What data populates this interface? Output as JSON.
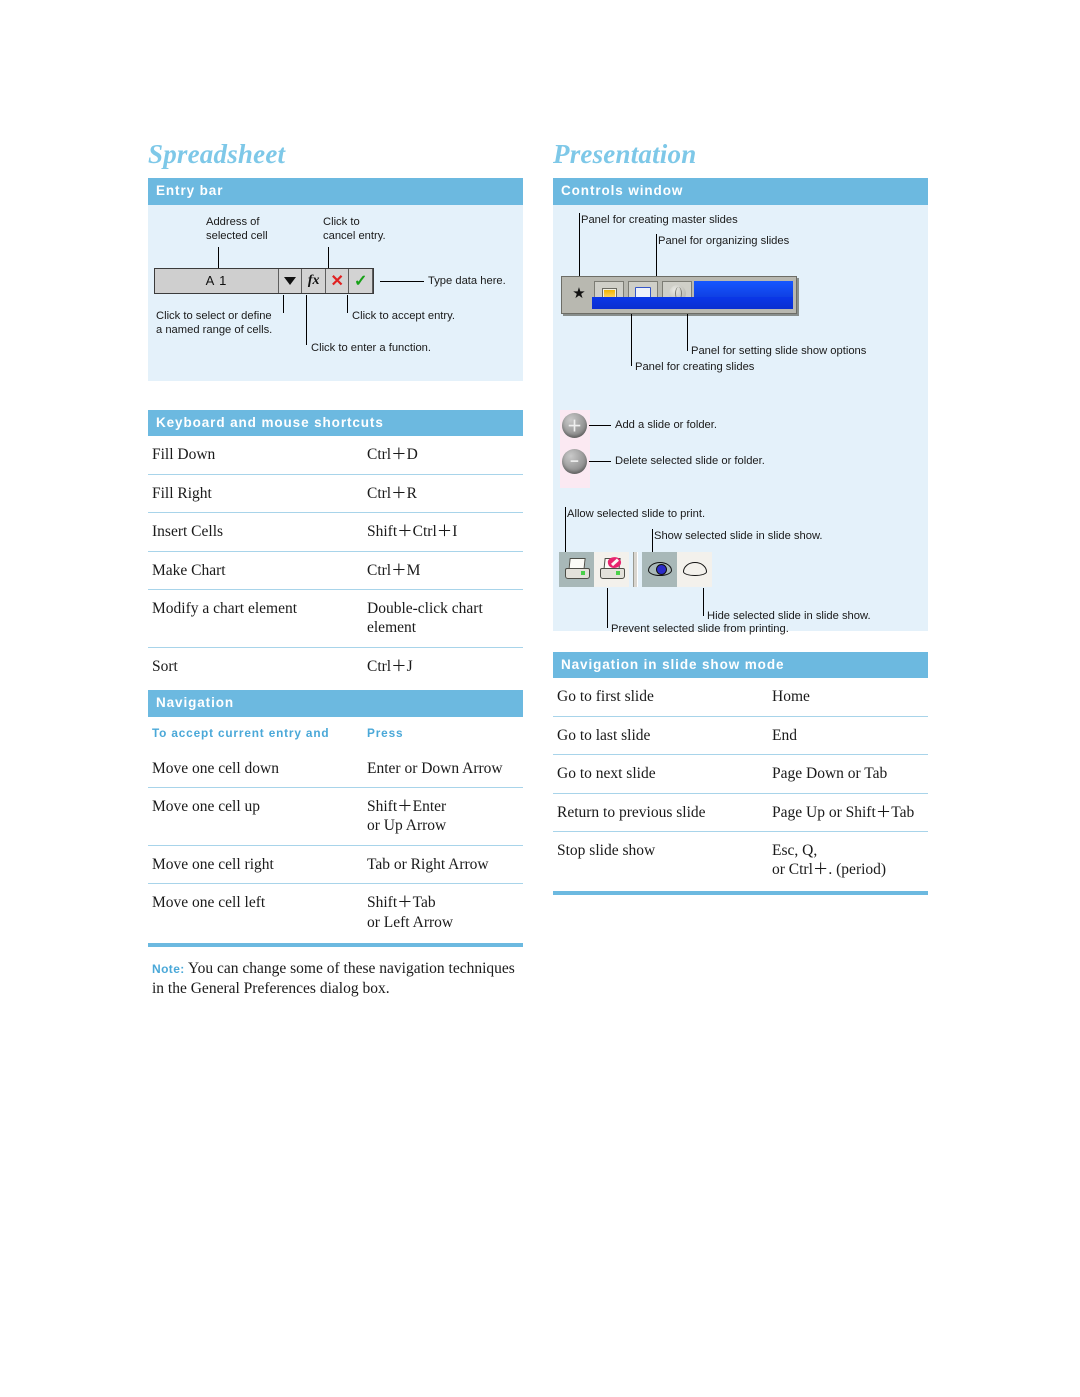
{
  "colors": {
    "accent_bar": "#6cb9e0",
    "title_blue": "#7ec8e8",
    "panel_bg": "#e4f1fa",
    "rule_blue": "#a8d4ea",
    "label_blue": "#4aa8d8"
  },
  "left": {
    "title": "Spreadsheet",
    "entry_bar": {
      "bar_label": "Entry bar",
      "callouts": {
        "address": "Address of\nselected cell",
        "cancel": "Click to\ncancel entry.",
        "type_here": "Type data here.",
        "named_range": "Click to select or define\na named range of cells.",
        "accept": "Click to accept entry.",
        "function": "Click to enter a function."
      },
      "widget": {
        "cell_address": "A 1",
        "dropdown_icon": "caret-down-icon",
        "function_label": "fx",
        "cancel_label": "✕",
        "accept_label": "✓"
      }
    },
    "shortcuts": {
      "bar_label": "Keyboard and mouse shortcuts",
      "rows": [
        {
          "action": "Fill Down",
          "keys": "Ctrl＋D"
        },
        {
          "action": "Fill Right",
          "keys": "Ctrl＋R"
        },
        {
          "action": "Insert Cells",
          "keys": "Shift＋Ctrl＋I"
        },
        {
          "action": "Make Chart",
          "keys": "Ctrl＋M"
        },
        {
          "action": "Modify a chart element",
          "keys": "Double-click chart element"
        },
        {
          "action": "Sort",
          "keys": "Ctrl＋J"
        }
      ]
    },
    "navigation": {
      "bar_label": "Navigation",
      "col1_header": "To accept current entry and",
      "col2_header": "Press",
      "rows": [
        {
          "action": "Move one cell down",
          "keys": "Enter or Down Arrow"
        },
        {
          "action": "Move one cell up",
          "keys": "Shift＋Enter\nor Up Arrow"
        },
        {
          "action": "Move one cell right",
          "keys": "Tab or Right Arrow"
        },
        {
          "action": "Move one cell left",
          "keys": "Shift＋Tab\nor Left Arrow"
        }
      ]
    },
    "note": {
      "label": "Note:",
      "text": "You can change some of these navigation techniques in the General Preferences dialog box."
    }
  },
  "right": {
    "title": "Presentation",
    "controls": {
      "bar_label": "Controls window",
      "callouts": {
        "master_slides": "Panel for creating master slides",
        "organizing": "Panel for organizing slides",
        "show_options": "Panel for setting slide show options",
        "creating_slides": "Panel for creating slides",
        "add": "Add a slide or folder.",
        "delete": "Delete selected slide or folder.",
        "allow_print": "Allow selected slide to print.",
        "show_slide": "Show selected slide in slide show.",
        "hide_slide": "Hide selected slide in slide show.",
        "prevent_print": "Prevent selected slide from printing."
      },
      "icons": {
        "master": "star-icon",
        "slide": "slide-icon",
        "folder": "folder-icon",
        "globe": "globe-icon",
        "add": "＋",
        "delete": "−",
        "print_allow": "printer-icon",
        "print_prevent": "printer-blocked-icon",
        "eye_show": "eye-open-icon",
        "eye_hide": "eye-closed-icon"
      }
    },
    "slideshow_nav": {
      "bar_label": "Navigation in slide show mode",
      "rows": [
        {
          "action": "Go to first slide",
          "keys": "Home"
        },
        {
          "action": "Go to last slide",
          "keys": "End"
        },
        {
          "action": "Go to next slide",
          "keys": "Page Down or Tab"
        },
        {
          "action": "Return to previous slide",
          "keys": "Page Up or Shift＋Tab"
        },
        {
          "action": "Stop slide show",
          "keys": "Esc, Q,\nor Ctrl＋. (period)"
        }
      ]
    }
  }
}
